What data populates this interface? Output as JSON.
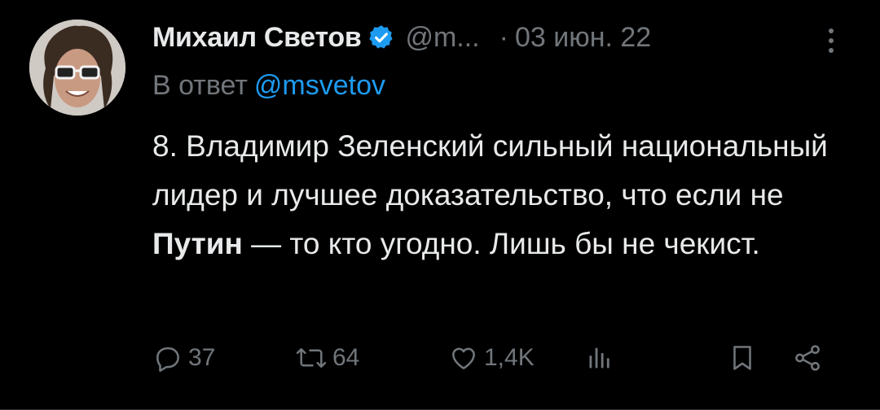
{
  "tweet": {
    "author_name": "Михаил Светов",
    "handle": "@m...",
    "separator": "·",
    "date": "03 июн. 22",
    "reply_prefix": "В ответ",
    "reply_to": "@msvetov",
    "text_part1": "8. Владимир Зеленский сильный национальный лидер и лучшее доказательство, что если не ",
    "text_bold": "Путин",
    "text_part2": " — то кто угодно. Лишь бы не чекист."
  },
  "actions": {
    "replies": "37",
    "retweets": "64",
    "likes": "1,4K"
  },
  "icons": [
    "verified-badge-icon",
    "more-icon",
    "reply-icon",
    "retweet-icon",
    "like-icon",
    "views-icon",
    "bookmark-icon",
    "share-icon"
  ],
  "colors": {
    "background": "#000000",
    "text": "#e7e9ea",
    "muted": "#71767b",
    "accent": "#1d9bf0"
  }
}
